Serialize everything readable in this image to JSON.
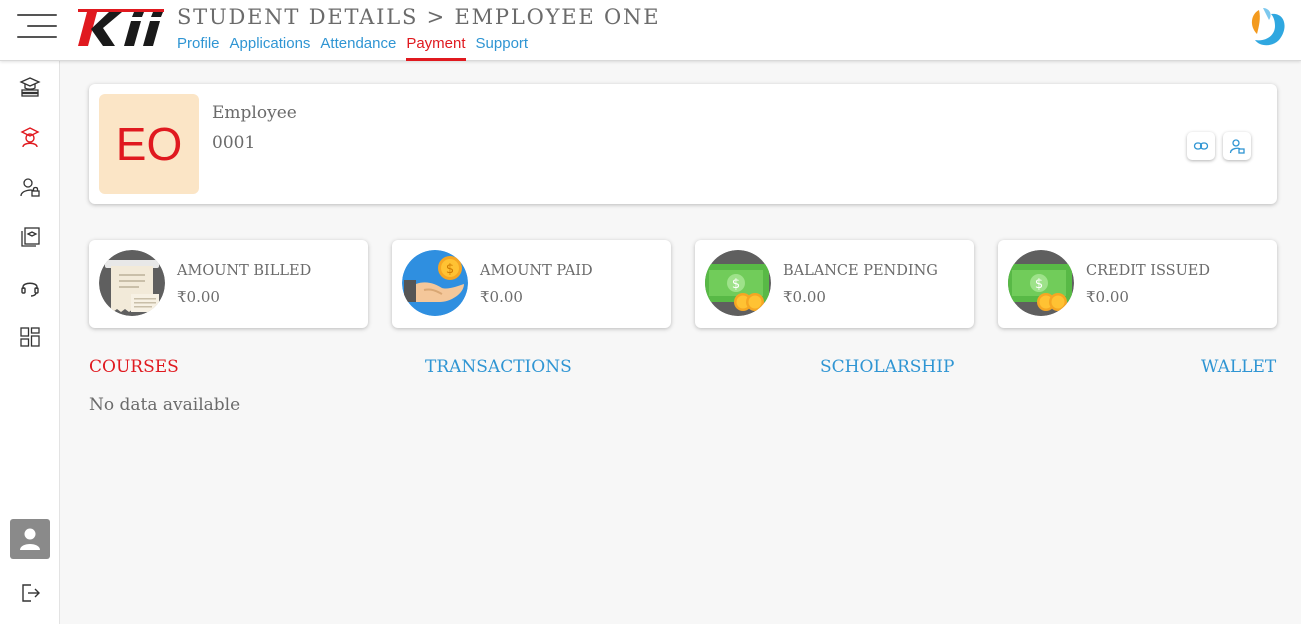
{
  "header": {
    "title": "STUDENT DETAILS > EMPLOYEE ONE",
    "tabs": [
      {
        "label": "Profile",
        "active": false
      },
      {
        "label": "Applications",
        "active": false
      },
      {
        "label": "Attendance",
        "active": false
      },
      {
        "label": "Payment",
        "active": true
      },
      {
        "label": "Support",
        "active": false
      }
    ]
  },
  "sidebar": {
    "items": [
      {
        "icon": "graduation-books-icon"
      },
      {
        "icon": "student-icon",
        "active": true
      },
      {
        "icon": "user-lock-icon"
      },
      {
        "icon": "courses-icon"
      },
      {
        "icon": "headset-icon"
      },
      {
        "icon": "dashboard-grid-icon"
      }
    ],
    "bottom": [
      {
        "icon": "avatar-icon"
      },
      {
        "icon": "logout-icon"
      }
    ]
  },
  "profile": {
    "initials": "EO",
    "first_name": "Employee",
    "second_line": "0001"
  },
  "stats": [
    {
      "label": "AMOUNT BILLED",
      "value": "₹0.00",
      "icon": "bill-icon"
    },
    {
      "label": "AMOUNT PAID",
      "value": "₹0.00",
      "icon": "hand-coin-icon"
    },
    {
      "label": "BALANCE PENDING",
      "value": "₹0.00",
      "icon": "cash-coins-icon"
    },
    {
      "label": "CREDIT ISSUED",
      "value": "₹0.00",
      "icon": "cash-coins-icon"
    }
  ],
  "sections": [
    {
      "label": "COURSES",
      "active": true
    },
    {
      "label": "TRANSACTIONS",
      "active": false
    },
    {
      "label": "SCHOLARSHIP",
      "active": false
    },
    {
      "label": "WALLET",
      "active": false
    }
  ],
  "empty_message": "No data available",
  "colors": {
    "accent_red": "#e0191f",
    "link_blue": "#2f95d3",
    "initials_bg": "#fbe5c6"
  }
}
